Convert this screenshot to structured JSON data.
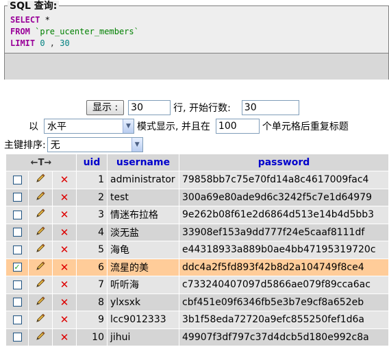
{
  "sql_box": {
    "legend": "SQL 查询:",
    "select_kw": "SELECT",
    "select_rest": " *",
    "from_kw": "FROM",
    "table": " `pre_ucenter_members`",
    "limit_kw": "LIMIT",
    "limit_offset": " 0",
    "limit_sep": " , ",
    "limit_count": "30"
  },
  "controls": {
    "show_button": "显示 :",
    "rows_value": "30",
    "start_label": "行, 开始行数:",
    "start_value": "30",
    "mode_prefix": "以",
    "mode_value": "水平",
    "mode_suffix": "模式显示, 并且在",
    "repeat_value": "100",
    "repeat_suffix": "个单元格后重复标题",
    "sort_label": "主键排序:",
    "sort_value": "无"
  },
  "table": {
    "arrows": "←T→",
    "headers": [
      "uid",
      "username",
      "password"
    ],
    "rows": [
      {
        "uid": "1",
        "username": "administrator",
        "password": "79858bb7c75e70fd14a8c4617009fac4",
        "checked": false
      },
      {
        "uid": "2",
        "username": "test",
        "password": "300a69e80ade9d6c3242f5c7e1d64979",
        "checked": false
      },
      {
        "uid": "3",
        "username": "情迷布拉格",
        "password": "9e262b08f61e2d6864d513e14b4d5bb3",
        "checked": false
      },
      {
        "uid": "4",
        "username": "淡无盐",
        "password": "33908ef153a9dd777f24e5caaf8111df",
        "checked": false
      },
      {
        "uid": "5",
        "username": "海龟",
        "password": "e44318933a889b0ae4bb47195319720c",
        "checked": false
      },
      {
        "uid": "6",
        "username": "流星的美",
        "password": "ddc4a2f5fd893f42b8d2a104749f8ce4",
        "checked": true
      },
      {
        "uid": "7",
        "username": "听听海",
        "password": "c733240407097d5866ae079f89cca6ac",
        "checked": false
      },
      {
        "uid": "8",
        "username": "ylxsxk",
        "password": "cbf451e09f6346fb5e3b7e9cf8a652eb",
        "checked": false
      },
      {
        "uid": "9",
        "username": "lcc9012333",
        "password": "3b1f58eda72720a9efc855250fef1d6a",
        "checked": false
      },
      {
        "uid": "10",
        "username": "jihui",
        "password": "49907f3df797c37d4dcb5d180e992c8a",
        "checked": false
      }
    ]
  },
  "colors": {
    "keyword": "#990099",
    "table_name": "#008000",
    "number": "#008080",
    "header_text": "#0000cc",
    "marked_row": "#ffcc99"
  },
  "icons": {
    "edit": "pencil-icon",
    "delete": "delete-x-icon",
    "checkbox": "checkbox"
  }
}
